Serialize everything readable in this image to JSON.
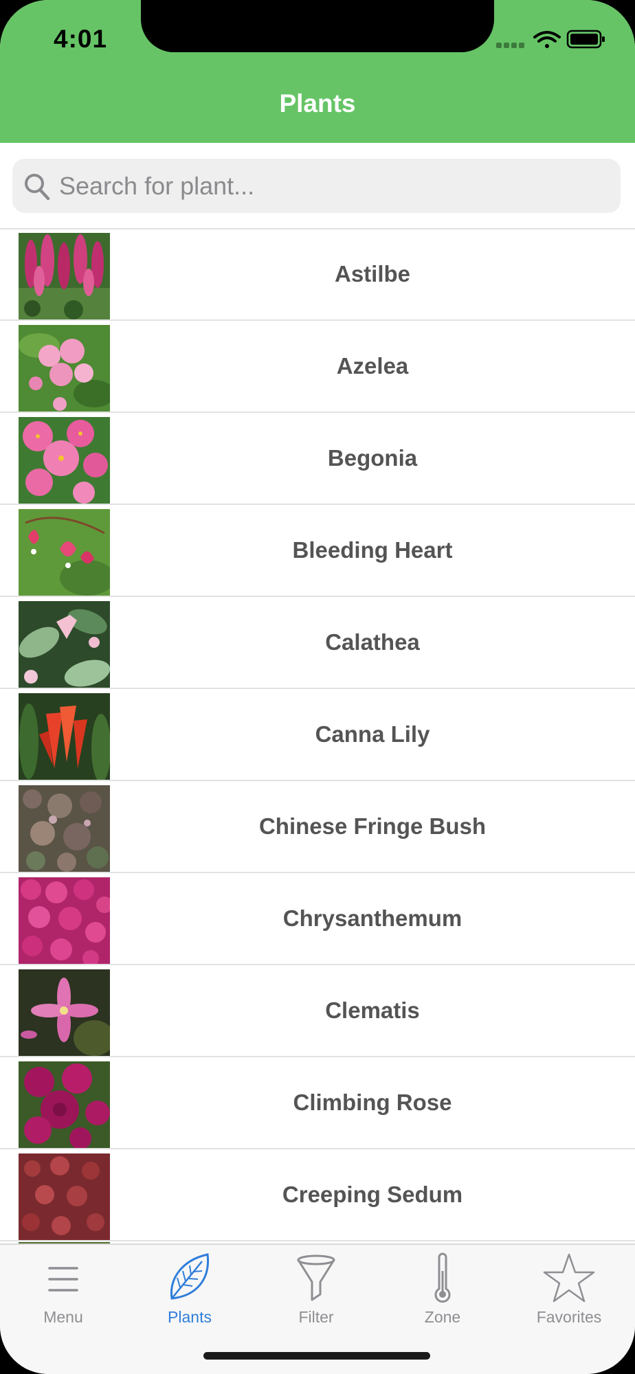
{
  "status_bar": {
    "time": "4:01"
  },
  "header": {
    "title": "Plants"
  },
  "search": {
    "placeholder": "Search for plant..."
  },
  "plants": [
    {
      "name": "Astilbe"
    },
    {
      "name": "Azelea"
    },
    {
      "name": "Begonia"
    },
    {
      "name": "Bleeding Heart"
    },
    {
      "name": "Calathea"
    },
    {
      "name": "Canna Lily"
    },
    {
      "name": "Chinese Fringe Bush"
    },
    {
      "name": "Chrysanthemum"
    },
    {
      "name": "Clematis"
    },
    {
      "name": "Climbing Rose"
    },
    {
      "name": "Creeping Sedum"
    }
  ],
  "tabbar": {
    "tabs": [
      {
        "label": "Menu",
        "icon": "hamburger-icon"
      },
      {
        "label": "Plants",
        "icon": "leaf-icon",
        "active": true
      },
      {
        "label": "Filter",
        "icon": "funnel-icon"
      },
      {
        "label": "Zone",
        "icon": "thermometer-icon"
      },
      {
        "label": "Favorites",
        "icon": "star-icon"
      }
    ]
  },
  "colors": {
    "header_bg": "#66c466",
    "active_tab": "#2f7ddb",
    "inactive_tab": "#8e8e93",
    "row_text": "#545454"
  }
}
